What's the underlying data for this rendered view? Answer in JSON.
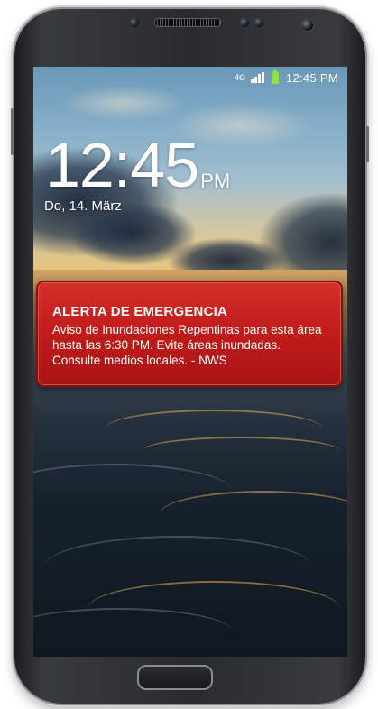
{
  "status_bar": {
    "network": "4G",
    "time": "12:45 PM",
    "battery_color": "#8fe24a"
  },
  "lock_screen": {
    "time": "12:45",
    "ampm": "PM",
    "date": "Do, 14. März"
  },
  "alert": {
    "title": "ALERTA DE EMERGENCIA",
    "message": "Aviso de Inundaciones Repentinas para esta área hasta las 6:30 PM. Evite áreas inundadas. Consulte medios locales. - NWS",
    "color": "#c21d1b"
  },
  "icons": {
    "network": "network-4g-icon",
    "signal": "signal-bars-icon",
    "battery": "battery-icon",
    "speaker": "earpiece-speaker-icon",
    "camera": "front-camera-icon",
    "home": "home-button-icon"
  }
}
